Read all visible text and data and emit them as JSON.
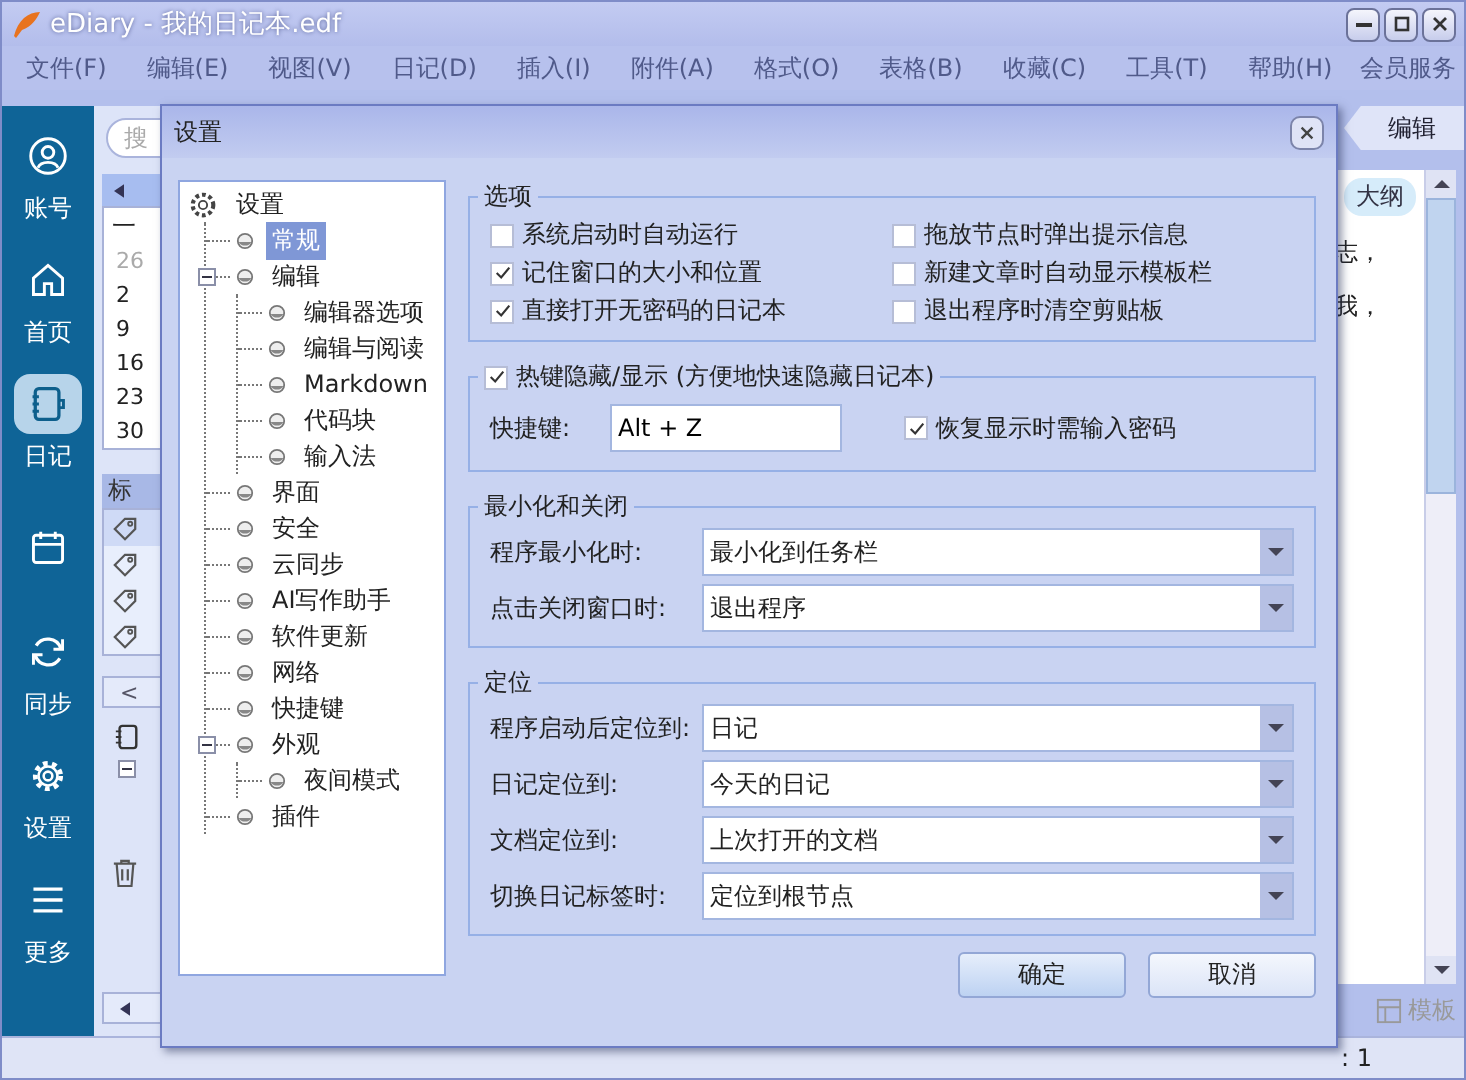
{
  "window": {
    "title": "eDiary - 我的日记本.edf"
  },
  "menu": [
    "文件(F)",
    "编辑(E)",
    "视图(V)",
    "日记(D)",
    "插入(I)",
    "附件(A)",
    "格式(O)",
    "表格(B)",
    "收藏(C)",
    "工具(T)",
    "帮助(H)"
  ],
  "member_link": "会员服务",
  "sidebar": [
    {
      "label": "账号",
      "selected": false
    },
    {
      "label": "首页",
      "selected": false
    },
    {
      "label": "日记",
      "selected": true
    },
    {
      "selected": false
    },
    {
      "label": "同步",
      "selected": false
    },
    {
      "label": "设置",
      "selected": false
    },
    {
      "label": "更多",
      "selected": false
    }
  ],
  "side_panel": {
    "search": {
      "placeholder": "搜"
    },
    "weekday": "一",
    "days": [
      {
        "label": "26",
        "other_month": true
      },
      {
        "label": "2",
        "other_month": false
      },
      {
        "label": "9",
        "other_month": false
      },
      {
        "label": "16",
        "other_month": false
      },
      {
        "label": "23",
        "other_month": false
      },
      {
        "label": "30",
        "other_month": false
      }
    ],
    "tags_header": "标",
    "tags": [
      {
        "selected": true
      },
      {
        "selected": false
      },
      {
        "selected": false
      },
      {
        "selected": false
      }
    ],
    "back_button": "<"
  },
  "editor": {
    "tab": "编辑",
    "outline_button": "大纲",
    "lines": [
      "志，",
      "我，"
    ],
    "template_button": "模板",
    "status": ": 1"
  },
  "dialog": {
    "title": "设置",
    "tree": {
      "label": "设置",
      "selected": false,
      "children": [
        {
          "label": "常规",
          "selected": true
        },
        {
          "label": "编辑",
          "selected": false,
          "expanded": true,
          "children": [
            {
              "label": "编辑器选项",
              "selected": false
            },
            {
              "label": "编辑与阅读",
              "selected": false
            },
            {
              "label": "Markdown",
              "selected": false
            },
            {
              "label": "代码块",
              "selected": false
            },
            {
              "label": "输入法",
              "selected": false
            }
          ]
        },
        {
          "label": "界面",
          "selected": false
        },
        {
          "label": "安全",
          "selected": false
        },
        {
          "label": "云同步",
          "selected": false
        },
        {
          "label": "AI写作助手",
          "selected": false
        },
        {
          "label": "软件更新",
          "selected": false
        },
        {
          "label": "网络",
          "selected": false
        },
        {
          "label": "快捷键",
          "selected": false
        },
        {
          "label": "外观",
          "selected": false,
          "expanded": true,
          "children": [
            {
              "label": "夜间模式",
              "selected": false
            }
          ]
        },
        {
          "label": "插件",
          "selected": false
        }
      ]
    },
    "options": {
      "title": "选项",
      "items": [
        {
          "label": "系统启动时自动运行",
          "checked": false
        },
        {
          "label": "记住窗口的大小和位置",
          "checked": true
        },
        {
          "label": "直接打开无密码的日记本",
          "checked": true
        },
        {
          "label": "拖放节点时弹出提示信息",
          "checked": false
        },
        {
          "label": "新建文章时自动显示模板栏",
          "checked": false
        },
        {
          "label": "退出程序时清空剪贴板",
          "checked": false
        }
      ]
    },
    "hotkey": {
      "label": "热键隐藏/显示 (方便地快速隐藏日记本)",
      "checked": true,
      "key_label": "快捷键:",
      "key_value": "Alt + Z",
      "password_label": "恢复显示时需输入密码",
      "password_checked": true
    },
    "minimize": {
      "title": "最小化和关闭",
      "fields": [
        {
          "label": "程序最小化时:",
          "value": "最小化到任务栏"
        },
        {
          "label": "点击关闭窗口时:",
          "value": "退出程序"
        }
      ]
    },
    "locate": {
      "title": "定位",
      "fields": [
        {
          "label": "程序启动后定位到:",
          "value": "日记"
        },
        {
          "label": "日记定位到:",
          "value": "今天的日记"
        },
        {
          "label": "文档定位到:",
          "value": "上次打开的文档"
        },
        {
          "label": "切换日记标签时:",
          "value": "定位到根节点"
        }
      ]
    },
    "buttons": [
      {
        "label": "确定",
        "default": true
      },
      {
        "label": "取消",
        "default": false
      }
    ]
  }
}
